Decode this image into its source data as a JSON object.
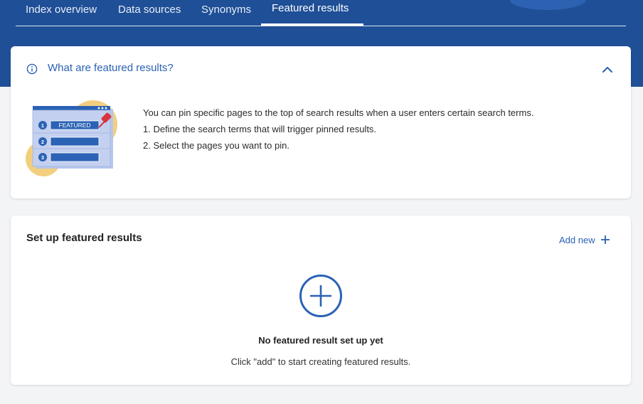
{
  "tabs": [
    {
      "label": "Index overview",
      "active": false
    },
    {
      "label": "Data sources",
      "active": false
    },
    {
      "label": "Synonyms",
      "active": false
    },
    {
      "label": "Featured results",
      "active": true
    }
  ],
  "info_panel": {
    "title": "What are featured results?",
    "info_icon": "info-circle-icon",
    "collapse_icon": "chevron-up-icon",
    "lines": [
      "You can pin specific pages to the top of search results when a user enters certain search terms.",
      "1. Define the search terms that will trigger pinned results.",
      "2. Select the pages you want to pin."
    ],
    "illustration": {
      "badge": "FEATURED",
      "numbers": [
        "1",
        "2",
        "3"
      ]
    }
  },
  "setup_panel": {
    "title": "Set up featured results",
    "add_new_label": "Add new",
    "add_icon": "plus-icon",
    "empty_icon": "plus-circle-icon",
    "empty_title": "No featured result set up yet",
    "empty_description": "Click \"add\" to start creating featured results."
  },
  "colors": {
    "header_background": "#1f4f97",
    "accent": "#2a62b5",
    "illustration_circle": "#f2cf7f",
    "pin": "#d9333f"
  }
}
